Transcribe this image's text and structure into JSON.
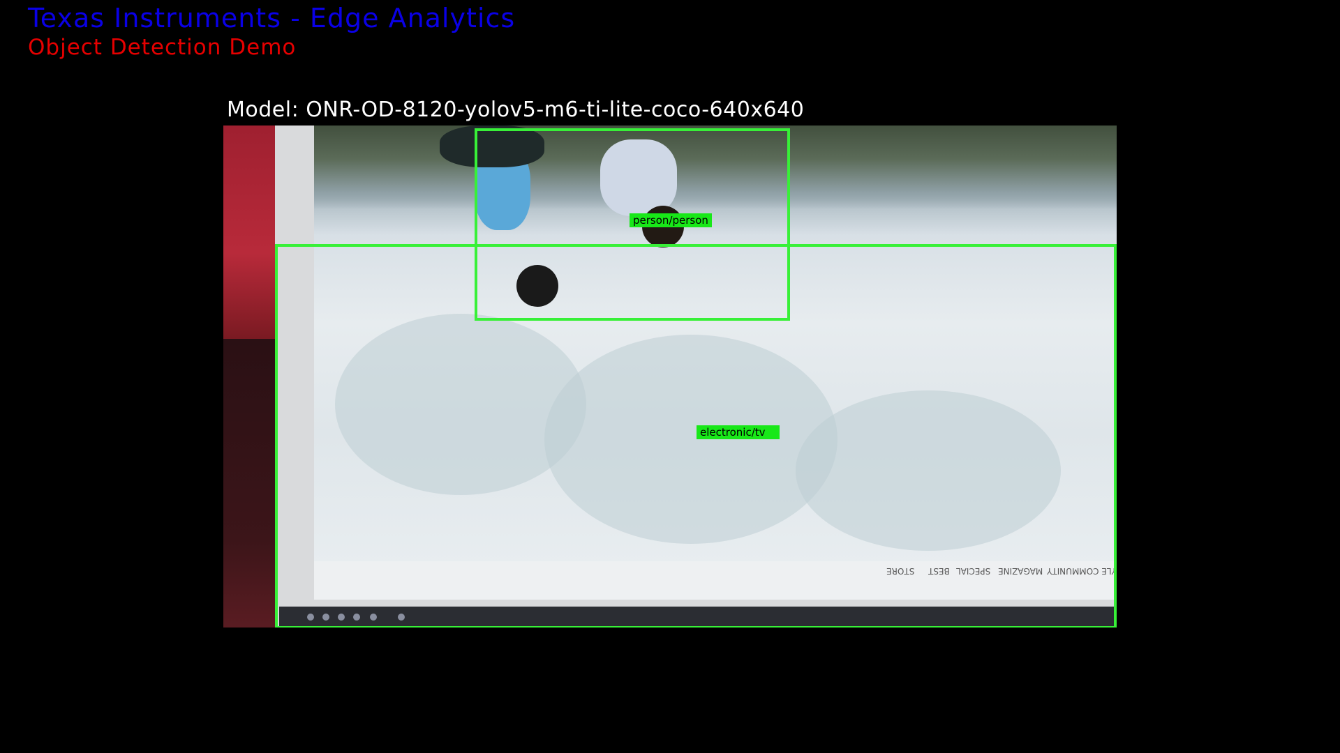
{
  "header": {
    "title": "Texas Instruments - Edge Analytics",
    "subtitle": "Object Detection Demo",
    "title_color": "#0a00e6",
    "subtitle_color": "#e60000"
  },
  "model": {
    "label": "Model: ONR-OD-8120-yolov5-m6-ti-lite-coco-640x640"
  },
  "detections": [
    {
      "label": "person/person",
      "color": "#38f038"
    },
    {
      "label": "electronic/tv",
      "color": "#38f038"
    }
  ],
  "footer_words": [
    "STORE",
    "BEST",
    "SPECIAL",
    "MAGAZINE",
    "STYLE COMMUNITY"
  ]
}
